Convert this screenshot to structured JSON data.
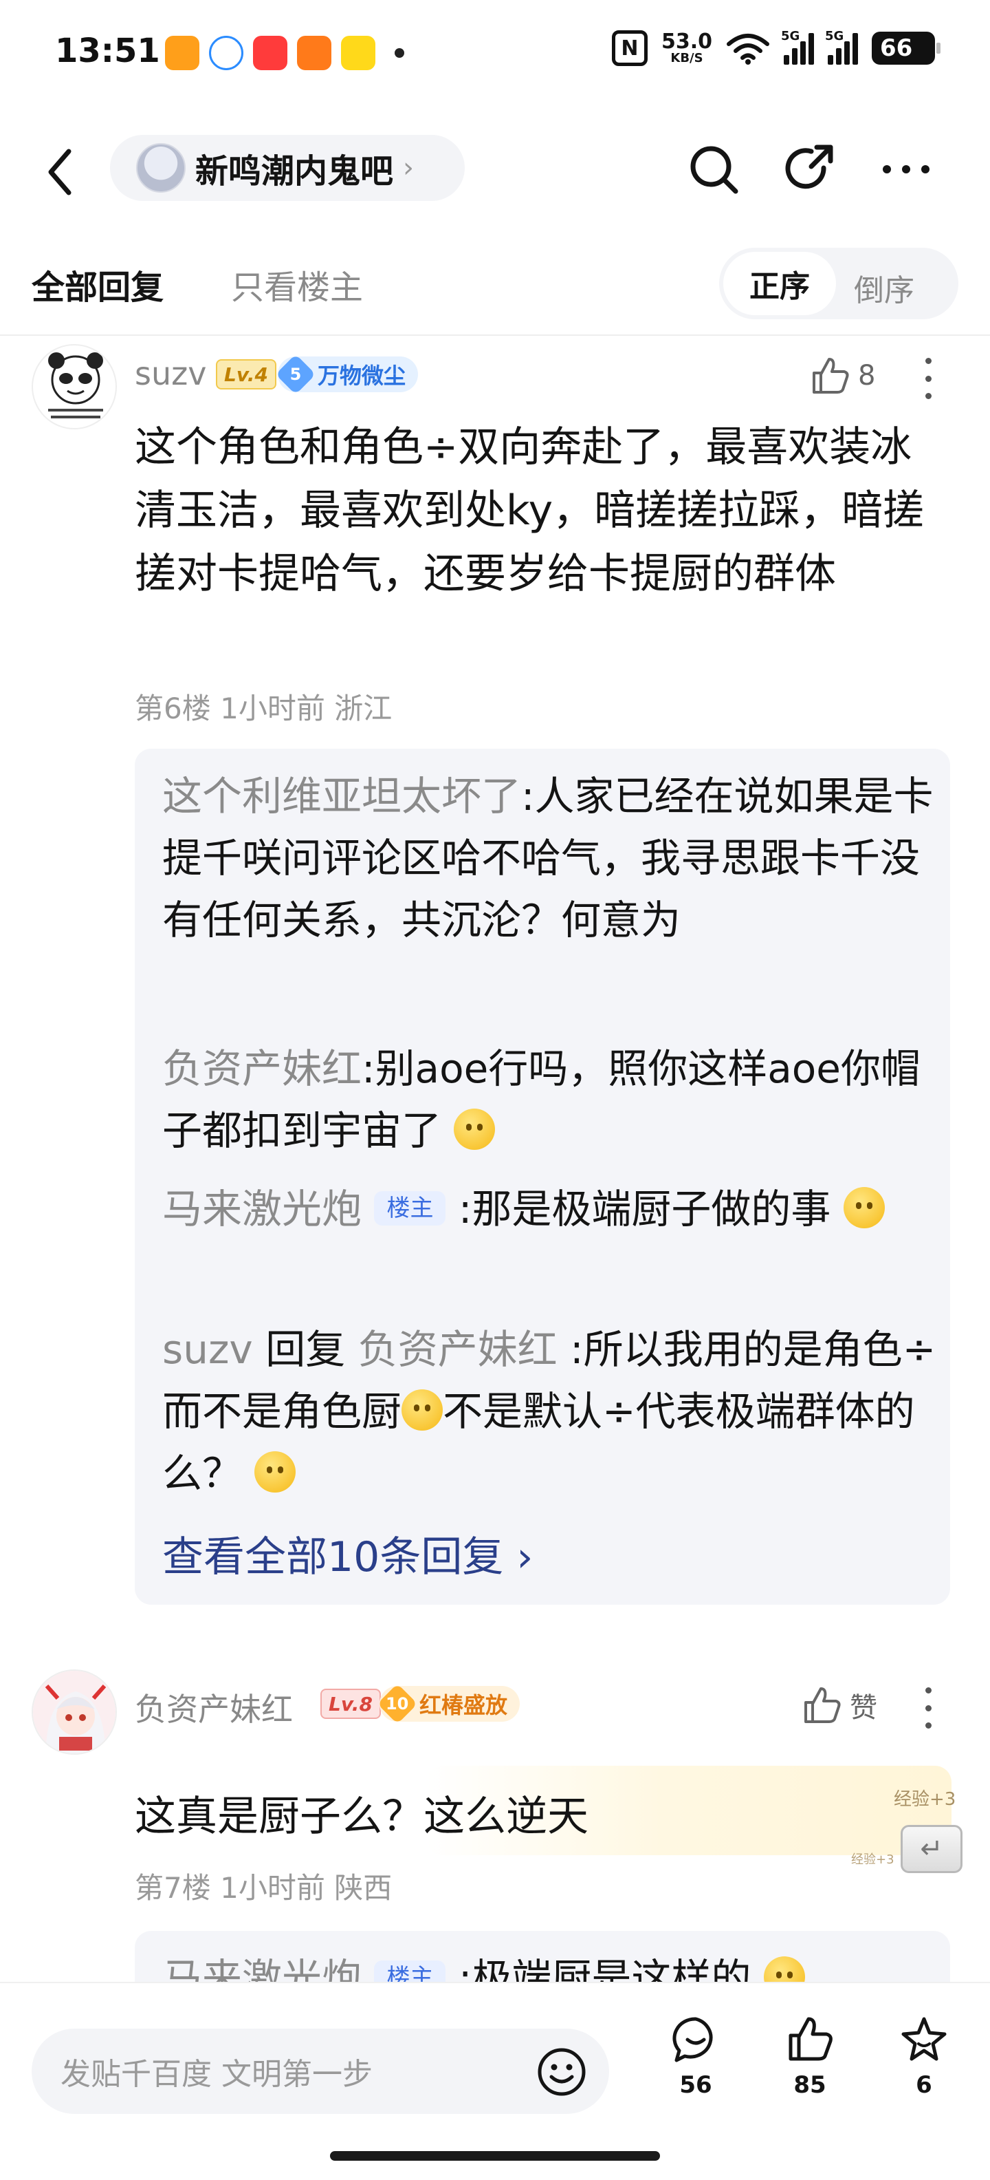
{
  "status_bar": {
    "time": "13:51",
    "net_speed": "53.0",
    "net_unit": "KB/S",
    "signal1": "5G",
    "signal2": "5G",
    "battery": "66"
  },
  "header": {
    "forum_name": "新鸣潮内鬼吧"
  },
  "tabs": {
    "all_replies": "全部回复",
    "op_only": "只看楼主",
    "order_asc": "正序",
    "order_desc": "倒序"
  },
  "comments": [
    {
      "username": "suzv",
      "level": "Lv.4",
      "badge_num": "5",
      "badge_label": "万物微尘",
      "like_count": "8",
      "content": "这个角色和角色÷双向奔赴了，最喜欢装冰清玉洁，最喜欢到处ky，暗搓搓拉踩，暗搓搓对卡提哈气，还要岁给卡提厨的群体",
      "floor": "第6楼",
      "time": "1小时前",
      "location": "浙江",
      "replies": [
        {
          "name": "这个利维亚坦太坏了",
          "text": ":人家已经在说如果是卡提千咲问评论区哈不哈气，我寻思跟卡千没有任何关系，共沉沦？何意为"
        },
        {
          "name": "负资产妹红",
          "text": ":别aoe行吗，照你这样aoe你帽子都扣到宇宙了"
        },
        {
          "name": "马来激光炮",
          "op_tag": "楼主",
          "text": ":那是极端厨子做的事"
        },
        {
          "name": "suzv",
          "reply_word": "回复",
          "target": "负资产妹红",
          "text": ":所以我用的是角色÷而不是角色厨",
          "text2": "不是默认÷代表极端群体的么？"
        }
      ],
      "view_all": "查看全部10条回复 ›"
    },
    {
      "username": "负资产妹红",
      "level": "Lv.8",
      "badge_num": "10",
      "badge_label": "红椿盛放",
      "like_label": "赞",
      "content": "这真是厨子么？这么逆天",
      "floor": "第7楼",
      "time": "1小时前",
      "location": "陕西",
      "exp_label": "经验+3",
      "exp_label_small": "经验+3",
      "partial_reply": {
        "name": "马来激光炮",
        "op_tag": "楼主",
        "text": ":极端厨是这样的"
      }
    }
  ],
  "bottom_bar": {
    "input_placeholder": "发贴千百度 文明第一步",
    "comment_count": "56",
    "like_count": "85",
    "fav_count": "6"
  }
}
